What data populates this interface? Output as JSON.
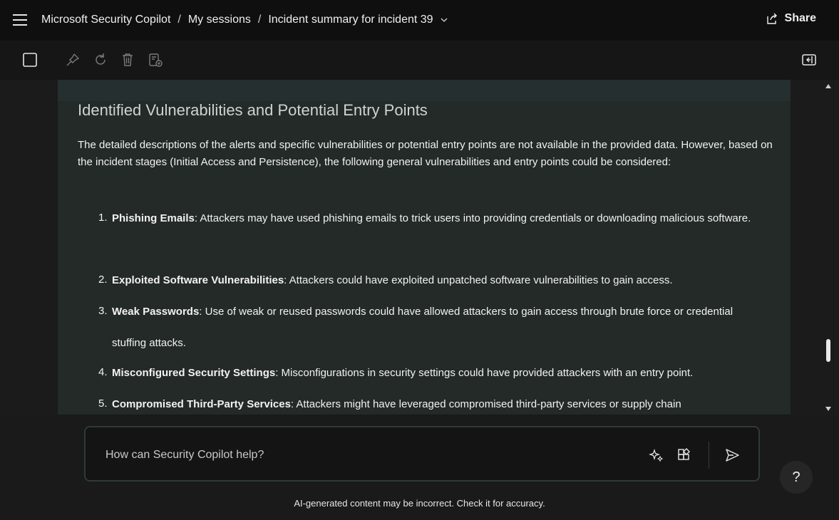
{
  "header": {
    "app_name": "Microsoft Security Copilot",
    "sep1": "/",
    "section": "My sessions",
    "sep2": "/",
    "session_title": "Incident summary for incident 39",
    "share_label": "Share"
  },
  "toolbar": {
    "icons": [
      "select-checkbox-icon",
      "pin-icon",
      "refresh-icon",
      "delete-icon",
      "export-icon",
      "collapse-panel-icon"
    ]
  },
  "content": {
    "heading": "Identified Vulnerabilities and Potential Entry Points",
    "intro": "The detailed descriptions of the alerts and specific vulnerabilities or potential entry points are not available in the provided data. However, based on the incident stages (Initial Access and Persistence), the following general vulnerabilities and entry points could be considered:",
    "items": [
      {
        "num": "1.",
        "title": "Phishing Emails",
        "text": ": Attackers may have used phishing emails to trick users into providing credentials or downloading malicious software."
      },
      {
        "num": "2.",
        "title": "Exploited Software Vulnerabilities",
        "text": ": Attackers could have exploited unpatched software vulnerabilities to gain access."
      },
      {
        "num": "3.",
        "title": "Weak Passwords",
        "text": ": Use of weak or reused passwords could have allowed attackers to gain access through brute force or credential stuffing attacks."
      },
      {
        "num": "4.",
        "title": "Misconfigured Security Settings",
        "text": ": Misconfigurations in security settings could have provided attackers with an entry point."
      },
      {
        "num": "5.",
        "title": "Compromised Third-Party Services",
        "text": ": Attackers might have leveraged compromised third-party services or supply chain"
      }
    ]
  },
  "prompt": {
    "placeholder": "How can Security Copilot help?"
  },
  "help_label": "?",
  "disclaimer": "AI-generated content may be incorrect. Check it for accuracy.",
  "colors": {
    "background": "#1a1a1a",
    "card": "#232a28",
    "text": "#f2f2f2"
  }
}
